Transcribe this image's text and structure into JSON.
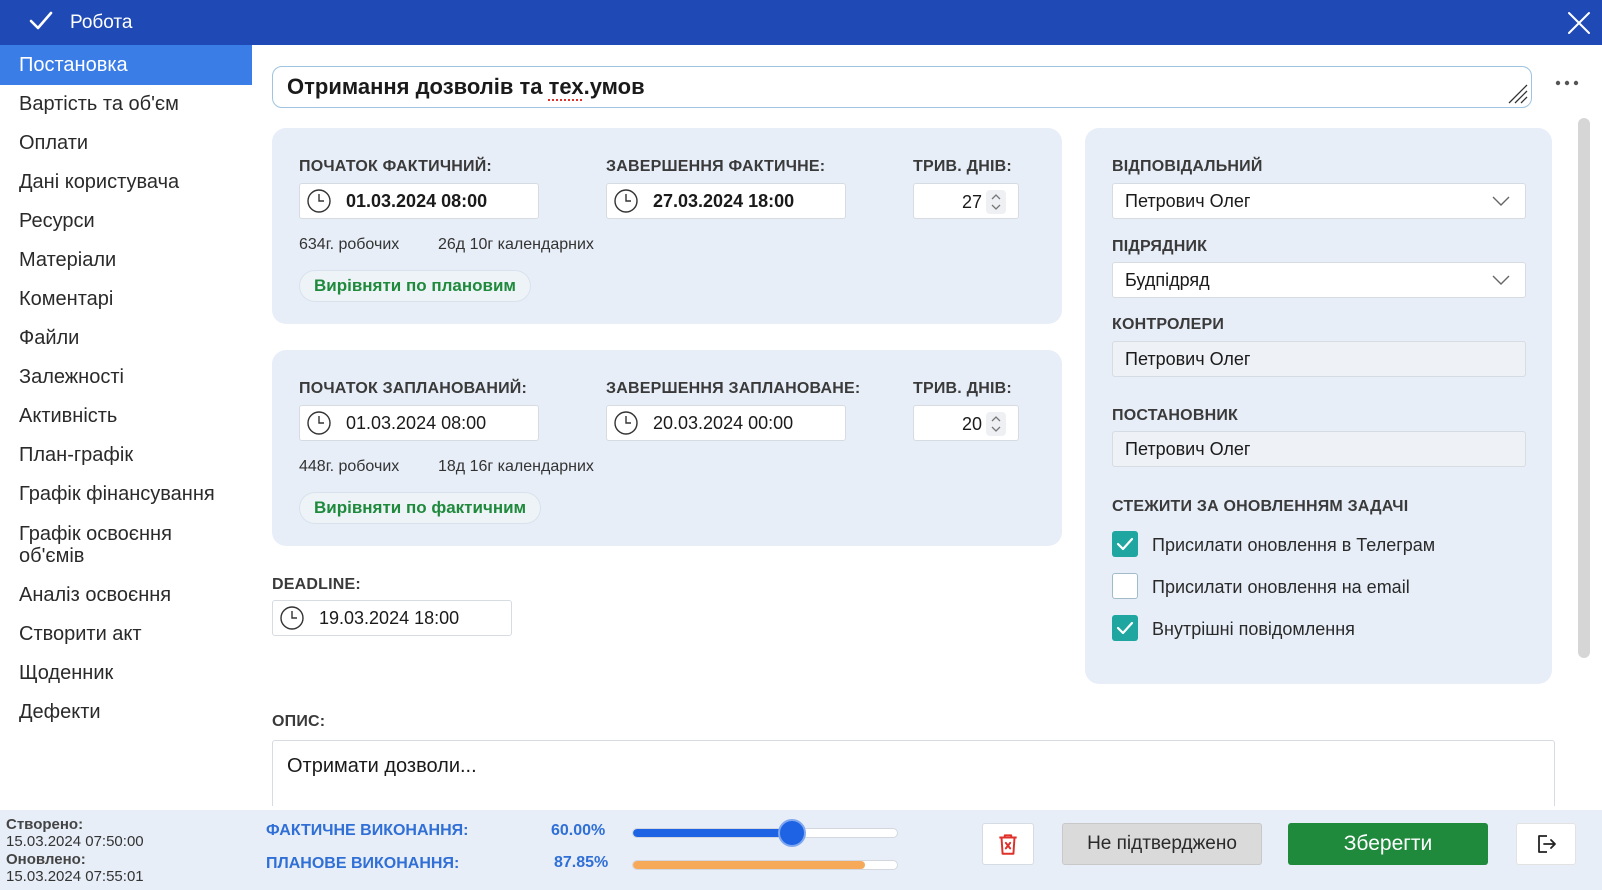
{
  "window": {
    "title": "Робота"
  },
  "sidebar": {
    "items": [
      {
        "label": "Постановка",
        "active": true
      },
      {
        "label": "Вартість та об'єм"
      },
      {
        "label": "Оплати"
      },
      {
        "label": "Дані користувача"
      },
      {
        "label": "Ресурси"
      },
      {
        "label": "Матеріали"
      },
      {
        "label": "Коментарі"
      },
      {
        "label": "Файли"
      },
      {
        "label": "Залежності"
      },
      {
        "label": "Активність"
      },
      {
        "label": "План-графік"
      },
      {
        "label": "Графік фінансування"
      },
      {
        "label": "Графік освоєння об'ємів"
      },
      {
        "label": "Аналіз освоєння"
      },
      {
        "label": "Створити акт"
      },
      {
        "label": "Щоденник"
      },
      {
        "label": "Дефекти"
      }
    ]
  },
  "task": {
    "title_prefix": "Отримання дозволів та ",
    "title_spell": "тех",
    "title_suffix": ".умов"
  },
  "actual": {
    "start_label": "ПОЧАТОК ФАКТИЧНИЙ:",
    "start_value": "01.03.2024 08:00",
    "end_label": "ЗАВЕРШЕННЯ ФАКТИЧНЕ:",
    "end_value": "27.03.2024 18:00",
    "duration_label": "ТРИВ. ДНІВ:",
    "duration_value": "27",
    "work_hours": "634г. робочих",
    "calendar": "26д 10г календарних",
    "align_button": "Вирівняти по плановим"
  },
  "planned": {
    "start_label": "ПОЧАТОК ЗАПЛАНОВАНИЙ:",
    "start_value": "01.03.2024 08:00",
    "end_label": "ЗАВЕРШЕННЯ ЗАПЛАНОВАНЕ:",
    "end_value": "20.03.2024 00:00",
    "duration_label": "ТРИВ. ДНІВ:",
    "duration_value": "20",
    "work_hours": "448г. робочих",
    "calendar": "18д 16г календарних",
    "align_button": "Вирівняти по фактичним"
  },
  "deadline": {
    "label": "DEADLINE:",
    "value": "19.03.2024 18:00"
  },
  "people": {
    "responsible_label": "ВІДПОВІДАЛЬНИЙ",
    "responsible_value": "Петрович Олег",
    "contractor_label": "ПІДРЯДНИК",
    "contractor_value": "Будпідряд",
    "controllers_label": "КОНТРОЛЕРИ",
    "controllers_value": "Петрович Олег",
    "creator_label": "ПОСТАНОВНИК",
    "creator_value": "Петрович Олег"
  },
  "follow": {
    "label": "СТЕЖИТИ ЗА ОНОВЛЕННЯМ ЗАДАЧІ",
    "options": [
      {
        "label": "Присилати оновлення в Телеграм",
        "checked": true
      },
      {
        "label": "Присилати оновлення на email",
        "checked": false
      },
      {
        "label": "Внутрішні повідомлення",
        "checked": true
      }
    ]
  },
  "description": {
    "label": "ОПИС:",
    "value": "Отримати дозволи..."
  },
  "footer": {
    "created_label": "Створено:",
    "created_value": "15.03.2024 07:50:00",
    "updated_label": "Оновлено:",
    "updated_value": "15.03.2024 07:55:01",
    "actual_progress_label": "ФАКТИЧНЕ ВИКОНАННЯ:",
    "actual_progress_value": "60.00%",
    "actual_progress_fraction": 0.6,
    "planned_progress_label": "ПЛАНОВЕ ВИКОНАННЯ:",
    "planned_progress_value": "87.85%",
    "planned_progress_fraction": 0.8785,
    "status_button": "Не підтверджено",
    "save_button": "Зберегти"
  },
  "colors": {
    "titlebar": "#1f4ab6",
    "accent": "#3b7de6",
    "save": "#1f8a3c",
    "checkbox": "#1fa6a0",
    "planned_fill": "#f7a95a",
    "actual_fill": "#1e63e4",
    "delete_icon": "#e0302a"
  }
}
